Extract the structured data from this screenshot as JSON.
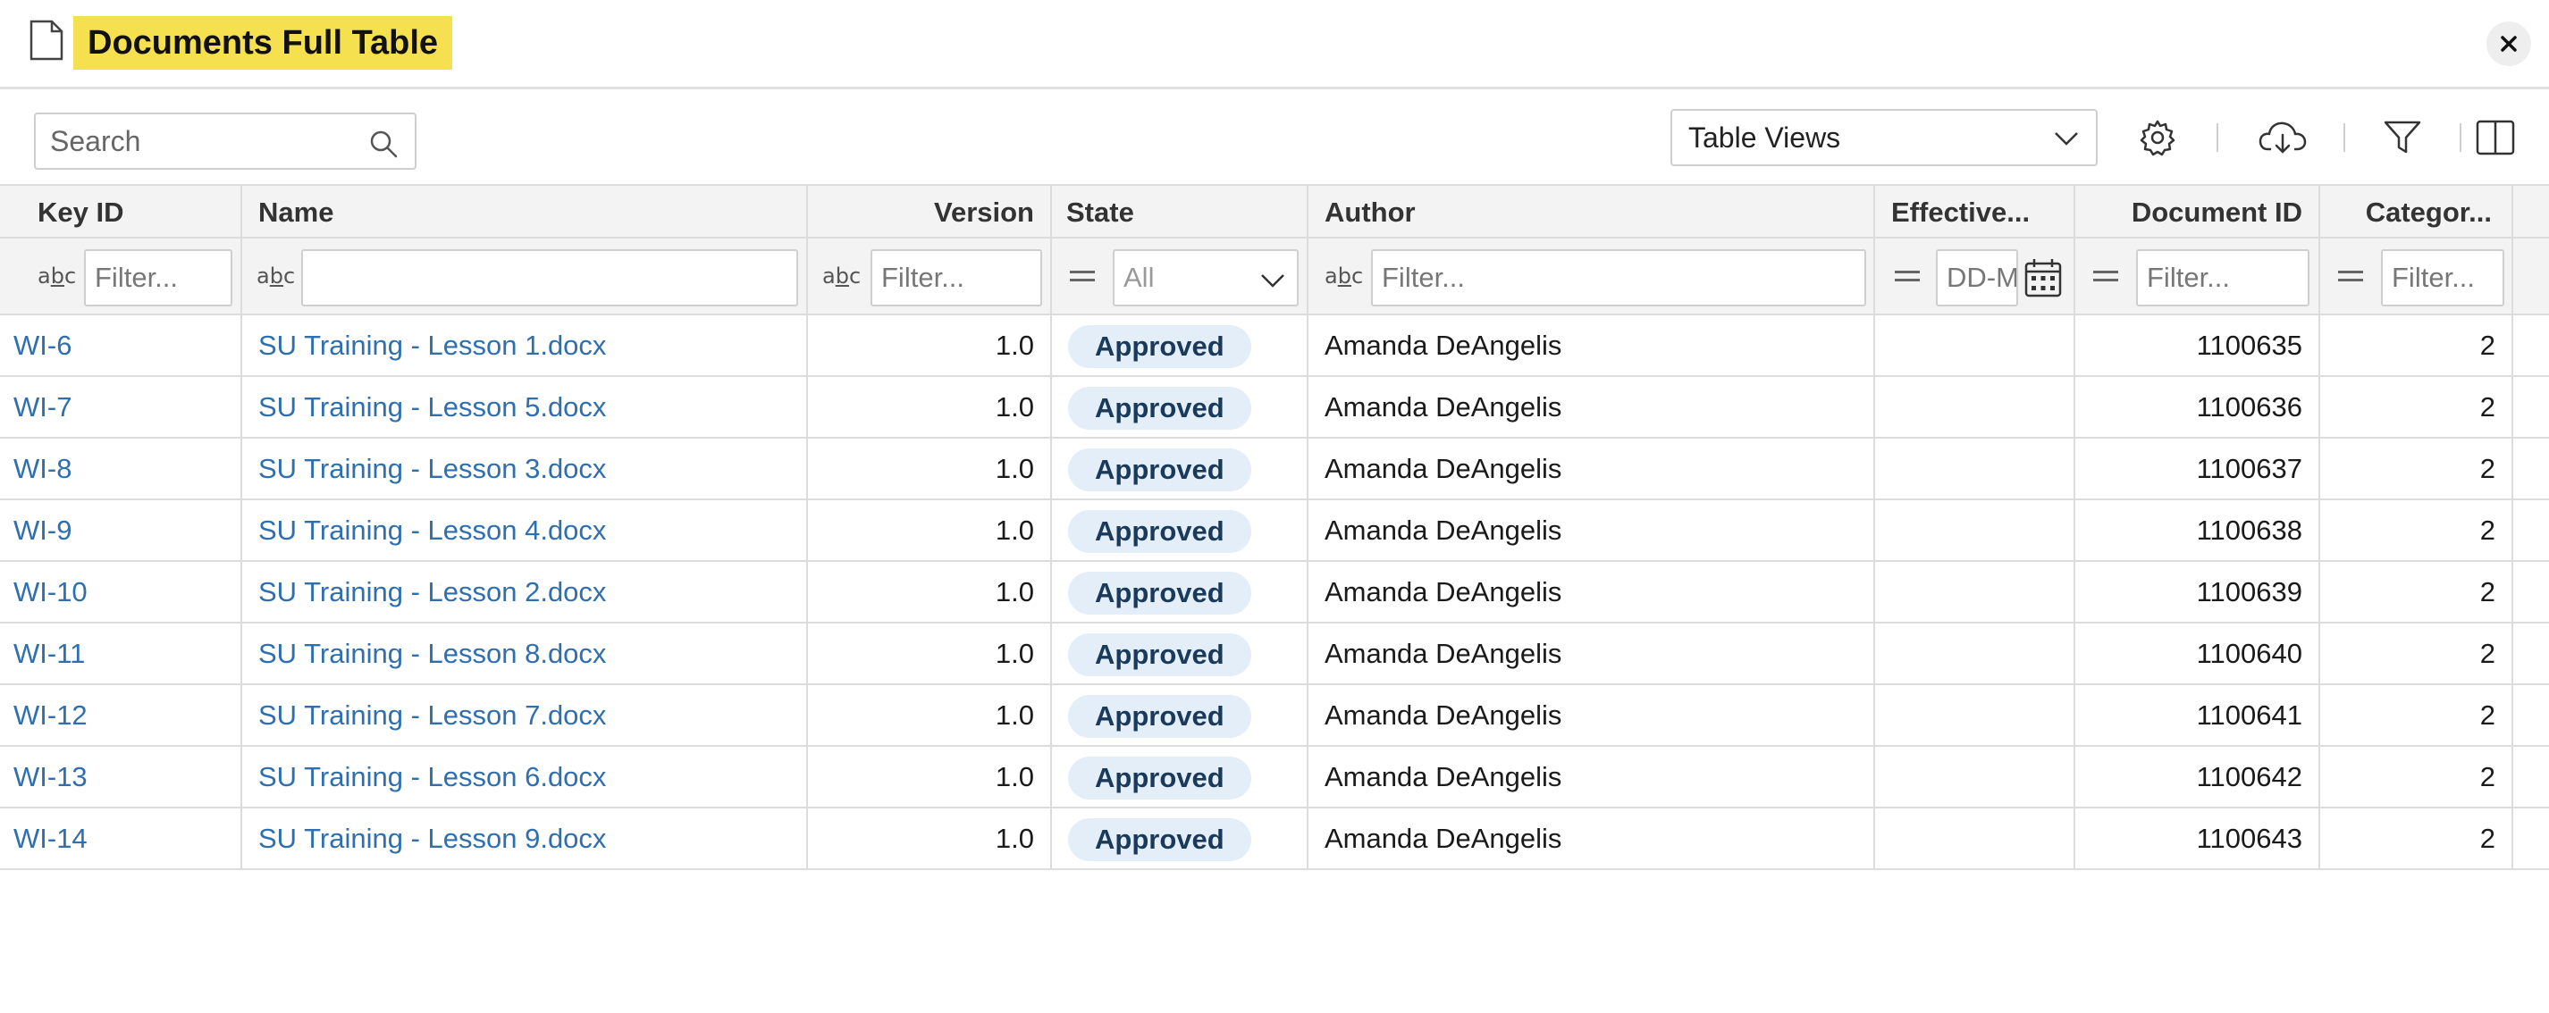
{
  "title": "Documents Full Table",
  "search": {
    "placeholder": "Search"
  },
  "table_views": {
    "label": "Table Views"
  },
  "columns": [
    "Key ID",
    "Name",
    "Version",
    "State",
    "Author",
    "Effective...",
    "Document ID",
    "Categor..."
  ],
  "filters": {
    "key_id_placeholder": "Filter...",
    "name_placeholder": "",
    "version_placeholder": "Filter...",
    "state_value": "All",
    "author_placeholder": "Filter...",
    "effective_placeholder": "DD-M",
    "document_id_placeholder": "Filter...",
    "category_placeholder": "Filter..."
  },
  "rows": [
    {
      "key_id": "WI-6",
      "name": "SU Training - Lesson 1.docx",
      "version": "1.0",
      "state": "Approved",
      "author": "Amanda DeAngelis",
      "effective": "",
      "document_id": "1100635",
      "category": "2"
    },
    {
      "key_id": "WI-7",
      "name": "SU Training - Lesson 5.docx",
      "version": "1.0",
      "state": "Approved",
      "author": "Amanda DeAngelis",
      "effective": "",
      "document_id": "1100636",
      "category": "2"
    },
    {
      "key_id": "WI-8",
      "name": "SU Training - Lesson 3.docx",
      "version": "1.0",
      "state": "Approved",
      "author": "Amanda DeAngelis",
      "effective": "",
      "document_id": "1100637",
      "category": "2"
    },
    {
      "key_id": "WI-9",
      "name": "SU Training - Lesson 4.docx",
      "version": "1.0",
      "state": "Approved",
      "author": "Amanda DeAngelis",
      "effective": "",
      "document_id": "1100638",
      "category": "2"
    },
    {
      "key_id": "WI-10",
      "name": "SU Training - Lesson 2.docx",
      "version": "1.0",
      "state": "Approved",
      "author": "Amanda DeAngelis",
      "effective": "",
      "document_id": "1100639",
      "category": "2"
    },
    {
      "key_id": "WI-11",
      "name": "SU Training - Lesson 8.docx",
      "version": "1.0",
      "state": "Approved",
      "author": "Amanda DeAngelis",
      "effective": "",
      "document_id": "1100640",
      "category": "2"
    },
    {
      "key_id": "WI-12",
      "name": "SU Training - Lesson 7.docx",
      "version": "1.0",
      "state": "Approved",
      "author": "Amanda DeAngelis",
      "effective": "",
      "document_id": "1100641",
      "category": "2"
    },
    {
      "key_id": "WI-13",
      "name": "SU Training - Lesson 6.docx",
      "version": "1.0",
      "state": "Approved",
      "author": "Amanda DeAngelis",
      "effective": "",
      "document_id": "1100642",
      "category": "2"
    },
    {
      "key_id": "WI-14",
      "name": "SU Training - Lesson 9.docx",
      "version": "1.0",
      "state": "Approved",
      "author": "Amanda DeAngelis",
      "effective": "",
      "document_id": "1100643",
      "category": "2"
    }
  ],
  "icons": {
    "title": "document-icon",
    "close": "close-icon",
    "search": "search-icon",
    "settings": "gear-icon",
    "download": "cloud-download-icon",
    "filter": "filter-icon",
    "columns": "columns-layout-icon",
    "text_filter": "text-type-icon",
    "equals_filter": "equals-icon",
    "calendar": "calendar-icon"
  },
  "colors": {
    "title_highlight": "#f5e150",
    "link": "#2f6fb0",
    "badge_bg": "#e3eef8"
  }
}
